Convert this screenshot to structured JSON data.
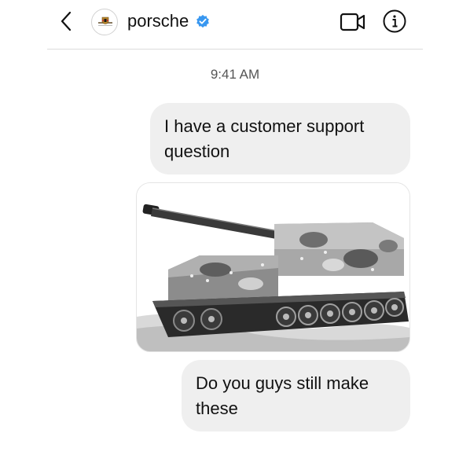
{
  "header": {
    "username": "porsche",
    "back_icon": "chevron-left-icon",
    "verified_icon": "verified-badge-icon",
    "video_icon": "video-camera-icon",
    "info_icon": "info-icon"
  },
  "thread": {
    "timestamp": "9:41 AM",
    "messages": [
      {
        "type": "text",
        "text": "I have a customer support question"
      },
      {
        "type": "image",
        "image": "tank-photo"
      },
      {
        "type": "text",
        "text": "Do you guys still make these"
      }
    ]
  },
  "colors": {
    "bubble": "#efefef",
    "verified": "#3897f0",
    "divider": "#dcdcdc"
  }
}
